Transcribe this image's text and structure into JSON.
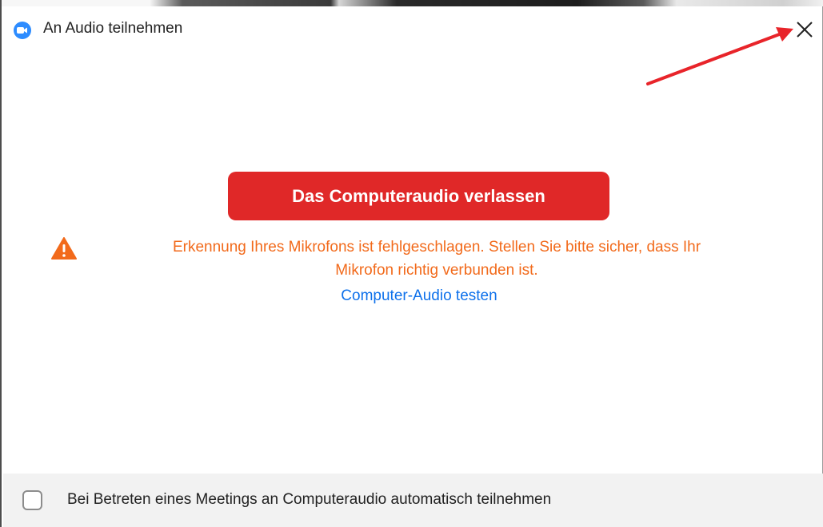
{
  "window": {
    "title": "An Audio teilnehmen",
    "app_icon": "zoom-camera-icon",
    "close_icon": "close-icon"
  },
  "main": {
    "leave_button_label": "Das Computeraudio verlassen",
    "warning_line1": "Erkennung Ihres Mikrofons ist fehlgeschlagen. Stellen Sie bitte sicher, dass Ihr",
    "warning_line2": "Mikrofon richtig verbunden ist.",
    "warning_icon": "warning-triangle-icon",
    "test_link": "Computer-Audio testen"
  },
  "footer": {
    "auto_join_label": "Bei Betreten eines Meetings an Computeraudio automatisch teilnehmen",
    "auto_join_checked": false
  },
  "colors": {
    "accent_blue": "#2d8cff",
    "button_red": "#e02828",
    "warning_orange": "#f26a1b",
    "link_blue": "#0e71eb",
    "annotation_arrow": "#e8242a"
  }
}
